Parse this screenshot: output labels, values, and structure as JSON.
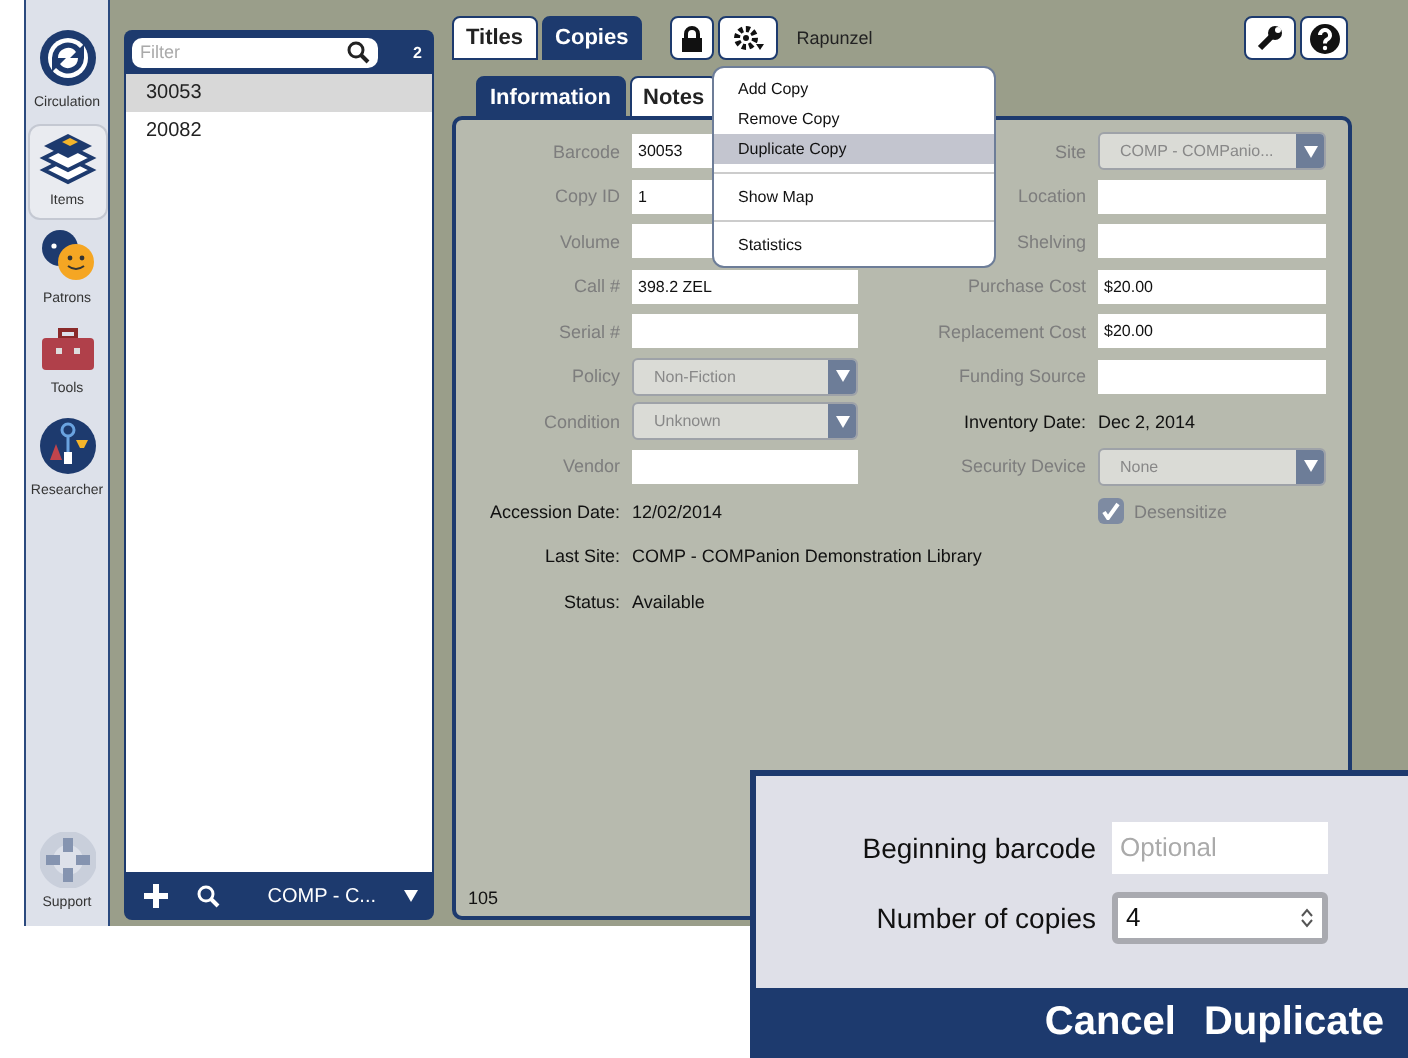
{
  "nav": {
    "items": [
      {
        "label": "Circulation",
        "selected": false
      },
      {
        "label": "Items",
        "selected": true
      },
      {
        "label": "Patrons",
        "selected": false
      },
      {
        "label": "Tools",
        "selected": false
      },
      {
        "label": "Researcher",
        "selected": false
      }
    ],
    "support": {
      "label": "Support"
    }
  },
  "list": {
    "filter": {
      "placeholder": "Filter"
    },
    "count": "2",
    "rows": [
      {
        "text": "30053",
        "selected": true
      },
      {
        "text": "20082",
        "selected": false
      }
    ],
    "site": "COMP - C..."
  },
  "toolbar": {
    "tabs": [
      {
        "label": "Titles",
        "selected": false
      },
      {
        "label": "Copies",
        "selected": true
      }
    ],
    "title": "Rapunzel"
  },
  "subtabs": [
    {
      "label": "Information",
      "selected": true
    },
    {
      "label": "Notes",
      "selected": false
    }
  ],
  "menu": [
    {
      "kind": "item",
      "label": "Add Copy",
      "highlighted": false
    },
    {
      "kind": "item",
      "label": "Remove Copy",
      "highlighted": false
    },
    {
      "kind": "item",
      "label": "Duplicate Copy",
      "highlighted": true
    },
    {
      "kind": "separator"
    },
    {
      "kind": "item",
      "label": "Show Map",
      "highlighted": false
    },
    {
      "kind": "separator"
    },
    {
      "kind": "item",
      "label": "Statistics",
      "highlighted": false
    }
  ],
  "left_fields": [
    {
      "kind": "input",
      "label": "Barcode",
      "value": "30053"
    },
    {
      "kind": "input",
      "label": "Copy ID",
      "value": "1"
    },
    {
      "kind": "input",
      "label": "Volume"
    },
    {
      "kind": "input",
      "label": "Call #",
      "value": "398.2 ZEL"
    },
    {
      "kind": "input",
      "label": "Serial #"
    },
    {
      "kind": "select",
      "label": "Policy",
      "value": "Non-Fiction"
    },
    {
      "kind": "select",
      "label": "Condition",
      "value": "Unknown"
    },
    {
      "kind": "input",
      "label": "Vendor"
    },
    {
      "kind": "text",
      "label": "Accession Date:",
      "value": "12/02/2014"
    },
    {
      "kind": "text",
      "label": "Last Site:",
      "value": "COMP - COMPanion Demonstration Library"
    },
    {
      "kind": "text",
      "label": "Status:",
      "value": "Available"
    }
  ],
  "right_fields": [
    {
      "kind": "select",
      "label": "Site",
      "value": "COMP - COMPanio..."
    },
    {
      "kind": "input",
      "label": "Location"
    },
    {
      "kind": "input",
      "label": "Shelving"
    },
    {
      "kind": "input",
      "label": "Purchase Cost",
      "value": "$20.00"
    },
    {
      "kind": "input",
      "label": "Replacement Cost",
      "value": "$20.00"
    },
    {
      "kind": "input",
      "label": "Funding Source"
    },
    {
      "kind": "text",
      "label": "Inventory Date:",
      "value": "Dec 2, 2014"
    },
    {
      "kind": "select",
      "label": "Security Device",
      "value": "None"
    },
    {
      "kind": "checkbox",
      "label": "Desensitize",
      "checked": true
    }
  ],
  "footer": "105",
  "dialog": {
    "fields": [
      {
        "kind": "text",
        "label": "Beginning barcode",
        "placeholder": "Optional"
      },
      {
        "kind": "number",
        "label": "Number of copies",
        "value": "4"
      }
    ],
    "buttons": [
      "Cancel",
      "Duplicate"
    ]
  }
}
